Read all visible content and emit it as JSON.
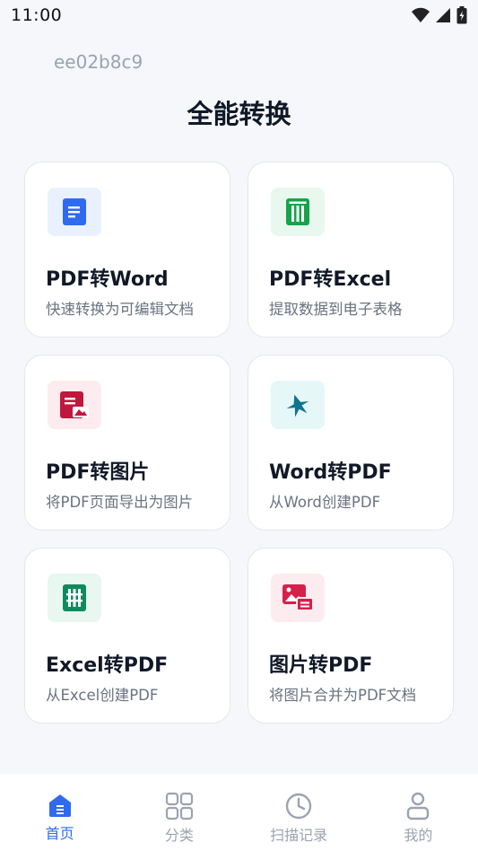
{
  "status_bar": {
    "time": "11:00"
  },
  "user_id": "ee02b8c9",
  "page_title": "全能转换",
  "cards": [
    {
      "title": "PDF转Word",
      "desc": "快速转换为可编辑文档",
      "icon": "document-icon",
      "icon_color": "#2f6bf0",
      "bg_color": "#eaf1fe"
    },
    {
      "title": "PDF转Excel",
      "desc": "提取数据到电子表格",
      "icon": "spreadsheet-icon",
      "icon_color": "#16a34a",
      "bg_color": "#e9f8ee"
    },
    {
      "title": "PDF转图片",
      "desc": "将PDF页面导出为图片",
      "icon": "image-document-icon",
      "icon_color": "#c0173e",
      "bg_color": "#fdecef"
    },
    {
      "title": "Word转PDF",
      "desc": "从Word创建PDF",
      "icon": "pdf-icon",
      "icon_color": "#0e7490",
      "bg_color": "#e6f7f8"
    },
    {
      "title": "Excel转PDF",
      "desc": "从Excel创建PDF",
      "icon": "table-icon",
      "icon_color": "#0f8a5f",
      "bg_color": "#e8f7ef"
    },
    {
      "title": "图片转PDF",
      "desc": "将图片合并为PDF文档",
      "icon": "photo-icon",
      "icon_color": "#d61f4b",
      "bg_color": "#fdecef"
    }
  ],
  "nav": [
    {
      "label": "首页",
      "icon": "home-icon",
      "active": true
    },
    {
      "label": "分类",
      "icon": "grid-icon",
      "active": false
    },
    {
      "label": "扫描记录",
      "icon": "clock-icon",
      "active": false
    },
    {
      "label": "我的",
      "icon": "profile-icon",
      "active": false
    }
  ],
  "colors": {
    "accent": "#2f6bf0",
    "inactive": "#9ca3af"
  }
}
